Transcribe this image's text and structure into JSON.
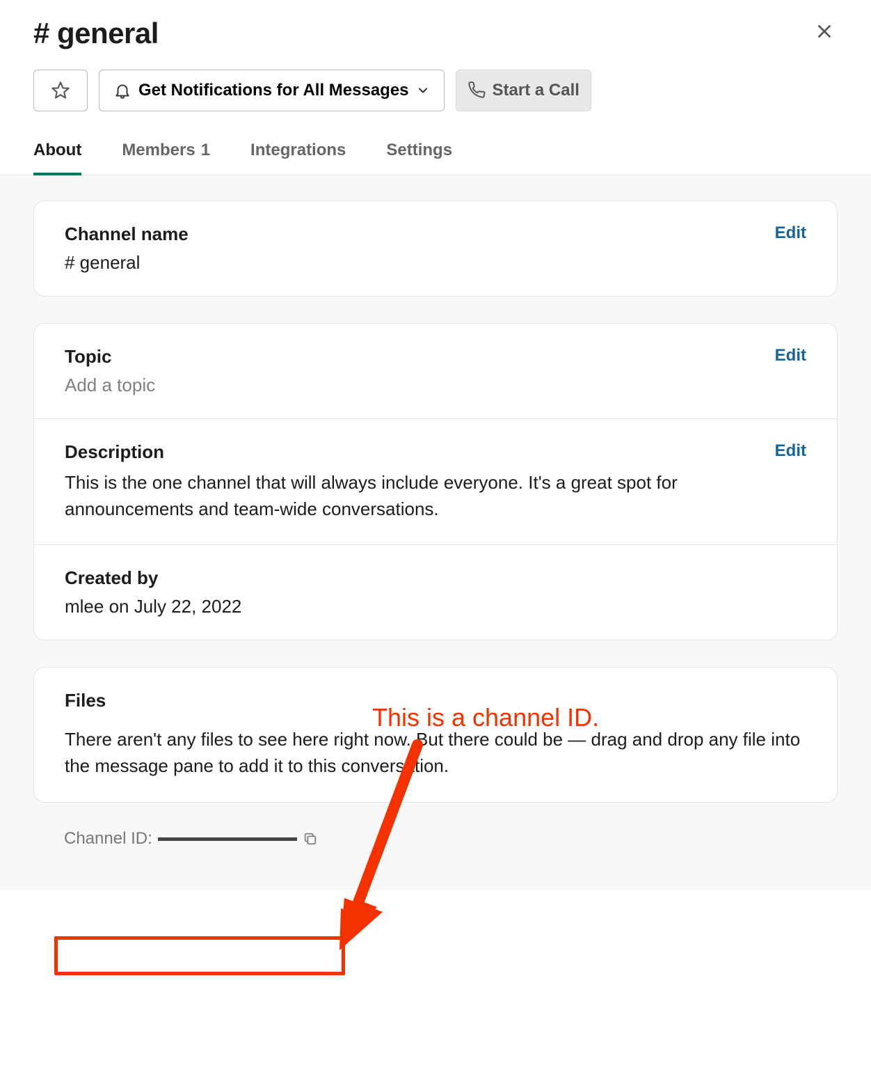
{
  "header": {
    "title": "# general"
  },
  "toolbar": {
    "notifications_label": "Get Notifications for All Messages",
    "call_label": "Start a Call"
  },
  "tabs": {
    "about": "About",
    "members_label": "Members",
    "members_count": "1",
    "integrations": "Integrations",
    "settings": "Settings"
  },
  "about": {
    "channel_name": {
      "label": "Channel name",
      "value": "# general",
      "edit": "Edit"
    },
    "topic": {
      "label": "Topic",
      "placeholder": "Add a topic",
      "edit": "Edit"
    },
    "description": {
      "label": "Description",
      "value": "This is the one channel that will always include everyone. It's a great spot for announcements and team-wide conversations.",
      "edit": "Edit"
    },
    "created_by": {
      "label": "Created by",
      "value": "mlee on July 22, 2022"
    },
    "files": {
      "label": "Files",
      "value": "There aren't any files to see here right now. But there could be — drag and drop any file into the message pane to add it to this conversation."
    },
    "channel_id": {
      "label": "Channel ID:"
    }
  },
  "annotation": {
    "callout": "This is a channel ID."
  }
}
